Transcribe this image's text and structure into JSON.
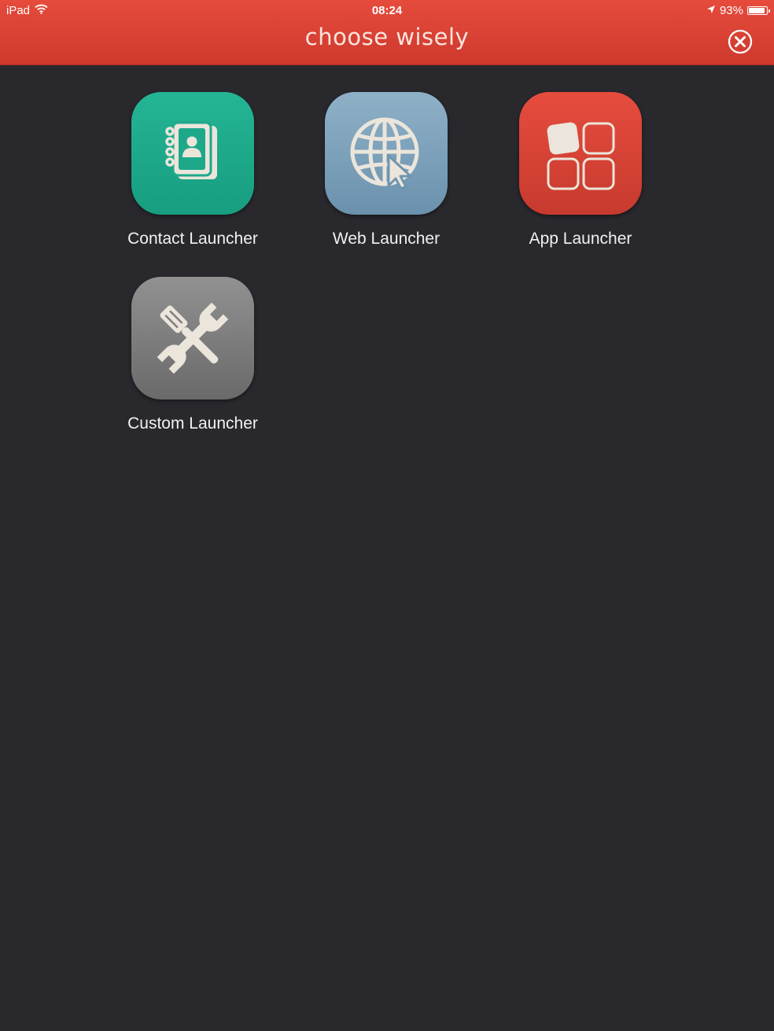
{
  "status_bar": {
    "device": "iPad",
    "time": "08:24",
    "battery": "93%",
    "battery_level": 0.93,
    "icons": [
      "wifi-icon",
      "location-arrow-icon",
      "battery-icon"
    ]
  },
  "header": {
    "title": "choose wisely",
    "close_icon": "close-icon"
  },
  "launchers": [
    {
      "label": "Contact Launcher",
      "icon": "contact-book-icon",
      "color": "#1faa8b"
    },
    {
      "label": "Web Launcher",
      "icon": "globe-cursor-icon",
      "color": "#7ea2bc"
    },
    {
      "label": "App Launcher",
      "icon": "app-grid-icon",
      "color": "#db4436"
    },
    {
      "label": "Custom Launcher",
      "icon": "tools-icon",
      "color": "#7f7f7f"
    }
  ],
  "colors": {
    "header": "#dd4536",
    "background": "#29282d",
    "icon_glyph": "#ebe5db"
  }
}
